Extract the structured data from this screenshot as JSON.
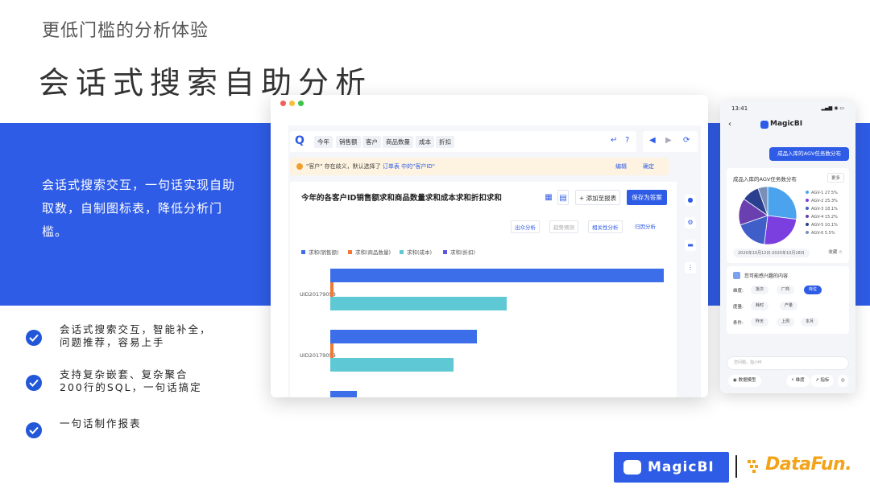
{
  "slide": {
    "subtitle": "更低门槛的分析体验",
    "title": "会话式搜索自助分析",
    "band_text": "会话式搜索交互，一句话实现自助取数，自制图标表，降低分析门槛。",
    "bullets": [
      "会话式搜索交互，智能补全，\n问题推荐，容易上手",
      "支持复杂嵌套、复杂聚合\n200行的SQL，一句话搞定",
      "一句话制作报表"
    ],
    "accent": "#2f5ce6"
  },
  "desktop": {
    "search_chips": [
      "今年",
      "销售额",
      "客户",
      "商品数量",
      "成本",
      "折扣"
    ],
    "notice": {
      "prefix": "\"客户\" 存在歧义，默认选择了",
      "link": "订单表 中的\"客户ID\"",
      "edit": "编辑",
      "confirm": "确定"
    },
    "card": {
      "title": "今年的各客户ID销售额求和商品数量求和成本求和折扣求和",
      "add_report": "+ 添加至报表",
      "save_answer": "保存为答案",
      "tools": [
        "出众分析",
        "趋势预测",
        "相关性分析",
        "归因分析"
      ]
    }
  },
  "chart_data": {
    "type": "bar",
    "orientation": "horizontal",
    "categories": [
      "UID20179058",
      "UID20179059",
      ""
    ],
    "series": [
      {
        "name": "求和(销售额)",
        "color": "#3b6ee8",
        "values": [
          100,
          44,
          8
        ]
      },
      {
        "name": "求和(商品数量)",
        "color": "#f07a35",
        "values": [
          1,
          1,
          0
        ]
      },
      {
        "name": "求和(成本)",
        "color": "#5ec8d4",
        "values": [
          53,
          37,
          0
        ]
      },
      {
        "name": "求和(折扣)",
        "color": "#6058d8",
        "values": [
          0,
          0,
          0
        ]
      }
    ],
    "grid": false,
    "legend": "top-left"
  },
  "mobile": {
    "time": "13:41",
    "brand": "MagicBI",
    "query": "成品入库的AGV任务数分布",
    "card_title": "成品入库的AGV任务数分布",
    "more": "更多",
    "pie": [
      {
        "label": "AGV-1 27.5%",
        "value": 27.5,
        "color": "#4aa3ec"
      },
      {
        "label": "AGV-2 25.3%",
        "value": 25.3,
        "color": "#7b3fe0"
      },
      {
        "label": "AGV-3 18.1%",
        "value": 18.1,
        "color": "#3f5ec8"
      },
      {
        "label": "AGV-4 15.2%",
        "value": 15.2,
        "color": "#6a3fb0"
      },
      {
        "label": "AGV-5 10.1%",
        "value": 10.1,
        "color": "#2a3f90"
      },
      {
        "label": "AGV-6 5.5%",
        "value": 5.5,
        "color": "#7a8fb8"
      }
    ],
    "date_range": "2020年10月12日-2020年10月18日",
    "favorite": "收藏 ☆",
    "interest_title": "您可能感兴趣的内容",
    "dims_label": "维度:",
    "dims": [
      "批次",
      "厂商",
      "库位"
    ],
    "measure_label": "度量:",
    "measures": [
      "耗时",
      "产量"
    ],
    "cond_label": "条件:",
    "conds": [
      "昨天",
      "上周",
      "本月"
    ],
    "input_placeholder": "您问题，指小M",
    "bottom": [
      "数据模型",
      "维度",
      "指标"
    ]
  },
  "logos": {
    "magicbi": "MagicBI",
    "datafun": "DataFun."
  }
}
